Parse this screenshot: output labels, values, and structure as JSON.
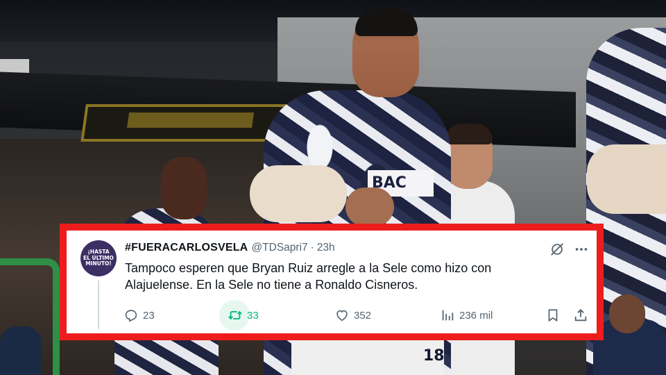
{
  "tweet": {
    "avatar_text": [
      "¡HASTA",
      "EL ÚLTIMO",
      "MINUTO!"
    ],
    "display_name": "#FUERACARLOSVELA",
    "handle": "@TDSapri7",
    "separator": "·",
    "time": "23h",
    "text_line1": "Tampoco esperen que Bryan Ruiz arregle a la Sele como hizo con",
    "text_line2": "Alajuelense. En la Sele no tiene a Ronaldo Cisneros.",
    "replies": "23",
    "retweets": "33",
    "likes": "352",
    "views": "236 mil",
    "colors": {
      "frame": "#ee1d1d",
      "retweet_active": "#00ba7c",
      "avatar_bg": "#3c2f64",
      "secondary_text": "#536471"
    },
    "icons": [
      "grok-icon",
      "more-icon",
      "reply-icon",
      "retweet-icon",
      "like-icon",
      "views-icon",
      "bookmark-icon",
      "share-icon"
    ]
  },
  "photo": {
    "jersey_sponsor": "BAC",
    "shorts_number": "18"
  }
}
